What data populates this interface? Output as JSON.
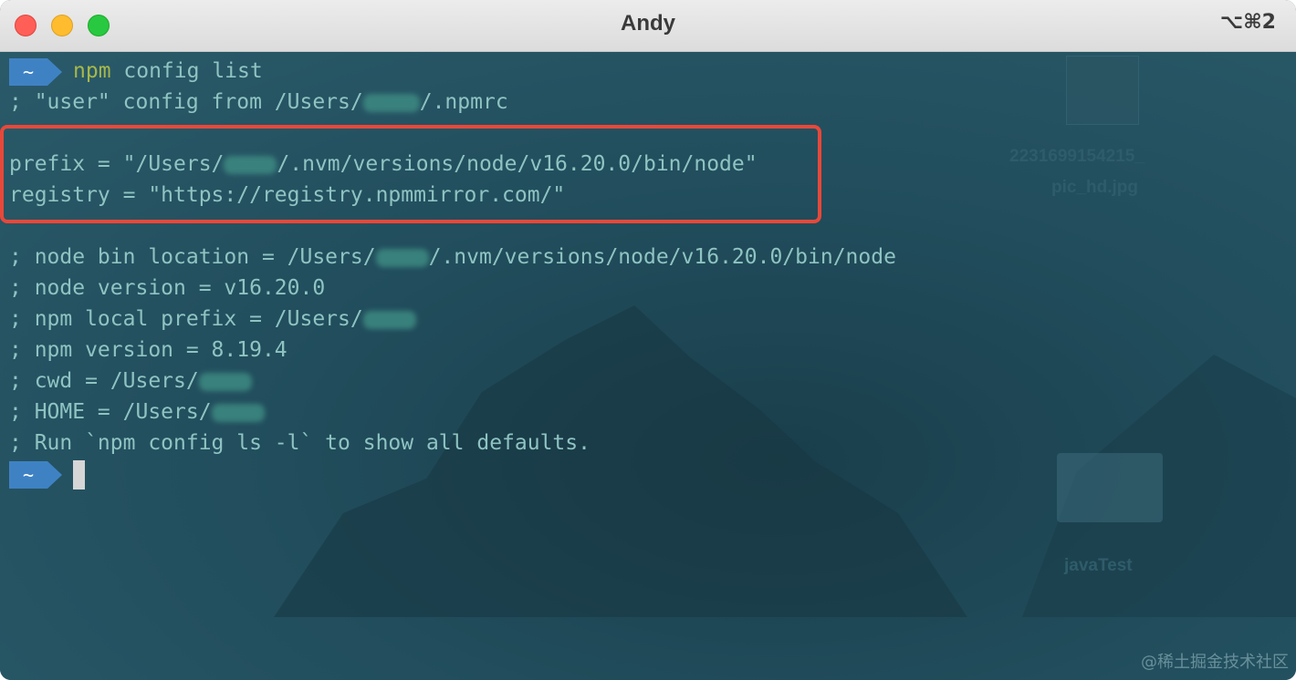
{
  "window": {
    "title": "Andy",
    "shortcut": "⌥⌘2"
  },
  "desktop": {
    "labels": [
      "2231699154215_",
      "pic_hd.jpg",
      "javaTest"
    ]
  },
  "prompt": {
    "symbol": "~"
  },
  "terminal": {
    "command": {
      "program": "npm",
      "args": " config list"
    },
    "user_config": {
      "before": "; \"user\" config from /Users/",
      "after": "/.npmrc"
    },
    "prefix": {
      "before": "prefix = \"/Users/",
      "after": "/.nvm/versions/node/v16.20.0/bin/node\""
    },
    "registry": "registry = \"https://registry.npmmirror.com/\"",
    "node_bin": {
      "before": "; node bin location = /Users/",
      "after": "/.nvm/versions/node/v16.20.0/bin/node"
    },
    "node_version": "; node version = v16.20.0",
    "npm_local_prefix": "; npm local prefix = /Users/",
    "npm_version": "; npm version = 8.19.4",
    "cwd": "; cwd = /Users/",
    "home": "; HOME = /Users/",
    "defaults_hint": "; Run `npm config ls -l` to show all defaults."
  },
  "watermark": "@稀土掘金技术社区",
  "colors": {
    "terminal_bg": "#1f4a58",
    "text": "#8fc4c2",
    "program": "#a7b84a",
    "prompt_bg": "#3f82c4",
    "highlight_border": "#e8483a"
  }
}
